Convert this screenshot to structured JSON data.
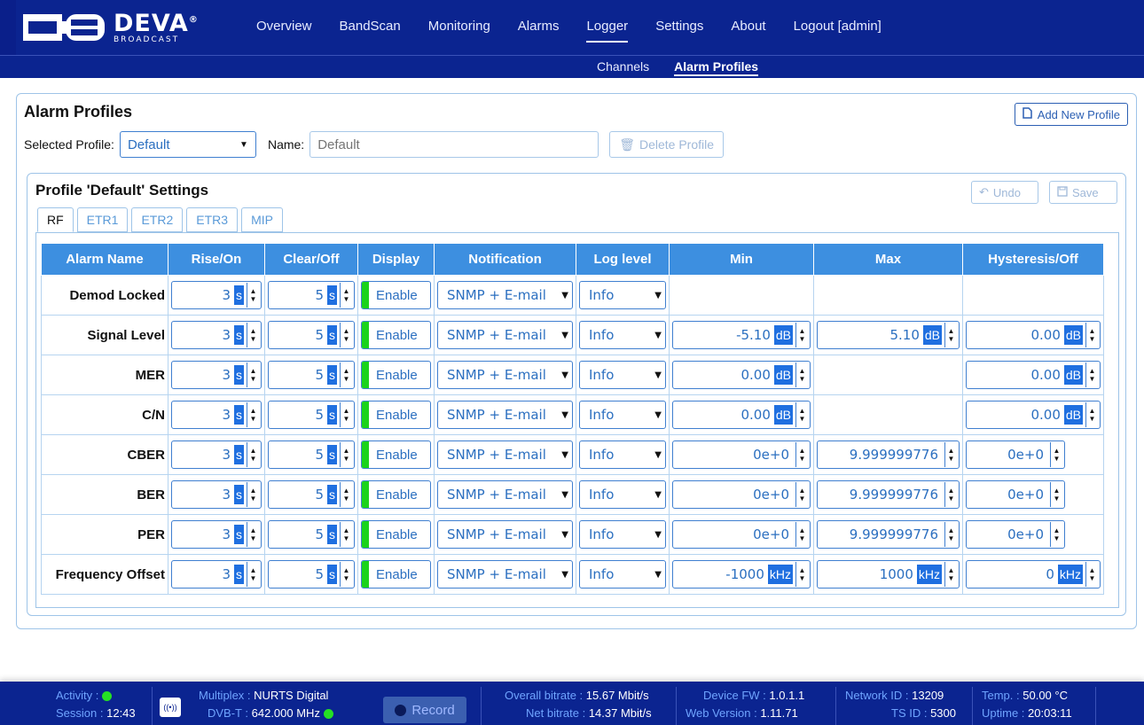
{
  "brand": {
    "name": "DEVA",
    "registered": "®",
    "tagline": "BROADCAST"
  },
  "nav": {
    "items": [
      "Overview",
      "BandScan",
      "Monitoring",
      "Alarms",
      "Logger",
      "Settings",
      "About",
      "Logout [admin]"
    ],
    "active": "Logger",
    "sub_items": [
      "Channels",
      "Alarm Profiles"
    ],
    "sub_active": "Alarm Profiles"
  },
  "page": {
    "title": "Alarm Profiles",
    "add_button": "Add New Profile",
    "selected_profile_label": "Selected Profile:",
    "selected_profile_value": "Default",
    "name_label": "Name:",
    "name_placeholder": "Default",
    "delete_button": "Delete Profile"
  },
  "settings": {
    "title": "Profile 'Default' Settings",
    "undo": "Undo",
    "save": "Save",
    "tabs": [
      "RF",
      "ETR1",
      "ETR2",
      "ETR3",
      "MIP"
    ],
    "active_tab": "RF"
  },
  "table": {
    "headers": [
      "Alarm Name",
      "Rise/On",
      "Clear/Off",
      "Display",
      "Notification",
      "Log level",
      "Min",
      "Max",
      "Hysteresis/Off"
    ],
    "rows": [
      {
        "name": "Demod Locked",
        "rise": "3",
        "rise_unit": "s",
        "clear": "5",
        "clear_unit": "s",
        "display": "Enable",
        "notification": "SNMP + E-mail",
        "log": "Info",
        "min": null,
        "min_unit": null,
        "max": null,
        "max_unit": null,
        "hyst": null,
        "hyst_unit": null
      },
      {
        "name": "Signal Level",
        "rise": "3",
        "rise_unit": "s",
        "clear": "5",
        "clear_unit": "s",
        "display": "Enable",
        "notification": "SNMP + E-mail",
        "log": "Info",
        "min": "-5.10",
        "min_unit": "dB",
        "max": "5.10",
        "max_unit": "dB",
        "hyst": "0.00",
        "hyst_unit": "dB"
      },
      {
        "name": "MER",
        "rise": "3",
        "rise_unit": "s",
        "clear": "5",
        "clear_unit": "s",
        "display": "Enable",
        "notification": "SNMP + E-mail",
        "log": "Info",
        "min": "0.00",
        "min_unit": "dB",
        "max": null,
        "max_unit": null,
        "hyst": "0.00",
        "hyst_unit": "dB"
      },
      {
        "name": "C/N",
        "rise": "3",
        "rise_unit": "s",
        "clear": "5",
        "clear_unit": "s",
        "display": "Enable",
        "notification": "SNMP + E-mail",
        "log": "Info",
        "min": "0.00",
        "min_unit": "dB",
        "max": null,
        "max_unit": null,
        "hyst": "0.00",
        "hyst_unit": "dB"
      },
      {
        "name": "CBER",
        "rise": "3",
        "rise_unit": "s",
        "clear": "5",
        "clear_unit": "s",
        "display": "Enable",
        "notification": "SNMP + E-mail",
        "log": "Info",
        "min": "0e+0",
        "min_unit": "",
        "max": "9.999999776",
        "max_unit": "",
        "hyst": "0e+0",
        "hyst_unit": ""
      },
      {
        "name": "BER",
        "rise": "3",
        "rise_unit": "s",
        "clear": "5",
        "clear_unit": "s",
        "display": "Enable",
        "notification": "SNMP + E-mail",
        "log": "Info",
        "min": "0e+0",
        "min_unit": "",
        "max": "9.999999776",
        "max_unit": "",
        "hyst": "0e+0",
        "hyst_unit": ""
      },
      {
        "name": "PER",
        "rise": "3",
        "rise_unit": "s",
        "clear": "5",
        "clear_unit": "s",
        "display": "Enable",
        "notification": "SNMP + E-mail",
        "log": "Info",
        "min": "0e+0",
        "min_unit": "",
        "max": "9.999999776",
        "max_unit": "",
        "hyst": "0e+0",
        "hyst_unit": ""
      },
      {
        "name": "Frequency Offset",
        "rise": "3",
        "rise_unit": "s",
        "clear": "5",
        "clear_unit": "s",
        "display": "Enable",
        "notification": "SNMP + E-mail",
        "log": "Info",
        "min": "-1000",
        "min_unit": "kHz",
        "max": "1000",
        "max_unit": "kHz",
        "hyst": "0",
        "hyst_unit": "kHz"
      }
    ]
  },
  "status": {
    "activity_label": "Activity :",
    "session_label": "Session :",
    "session_value": "12:43",
    "multiplex_label": "Multiplex :",
    "multiplex_value": "NURTS Digital",
    "dvbt_label": "DVB-T :",
    "dvbt_value": "642.000 MHz",
    "record_label": "Record",
    "overall_label": "Overall bitrate :",
    "overall_value": "15.67 Mbit/s",
    "net_label": "Net bitrate :",
    "net_value": "14.37 Mbit/s",
    "fw_label": "Device FW :",
    "fw_value": "1.0.1.1",
    "web_label": "Web Version :",
    "web_value": "1.11.71",
    "netid_label": "Network ID :",
    "netid_value": "13209",
    "tsid_label": "TS ID :",
    "tsid_value": "5300",
    "temp_label": "Temp. :",
    "temp_value": "50.00 °C",
    "uptime_label": "Uptime :",
    "uptime_value": "20:03:11"
  },
  "colors": {
    "nav_bg": "#0b2490",
    "header_blue": "#3d8fe0",
    "enable_green": "#1bd31b",
    "accent": "#2b6fc0"
  }
}
